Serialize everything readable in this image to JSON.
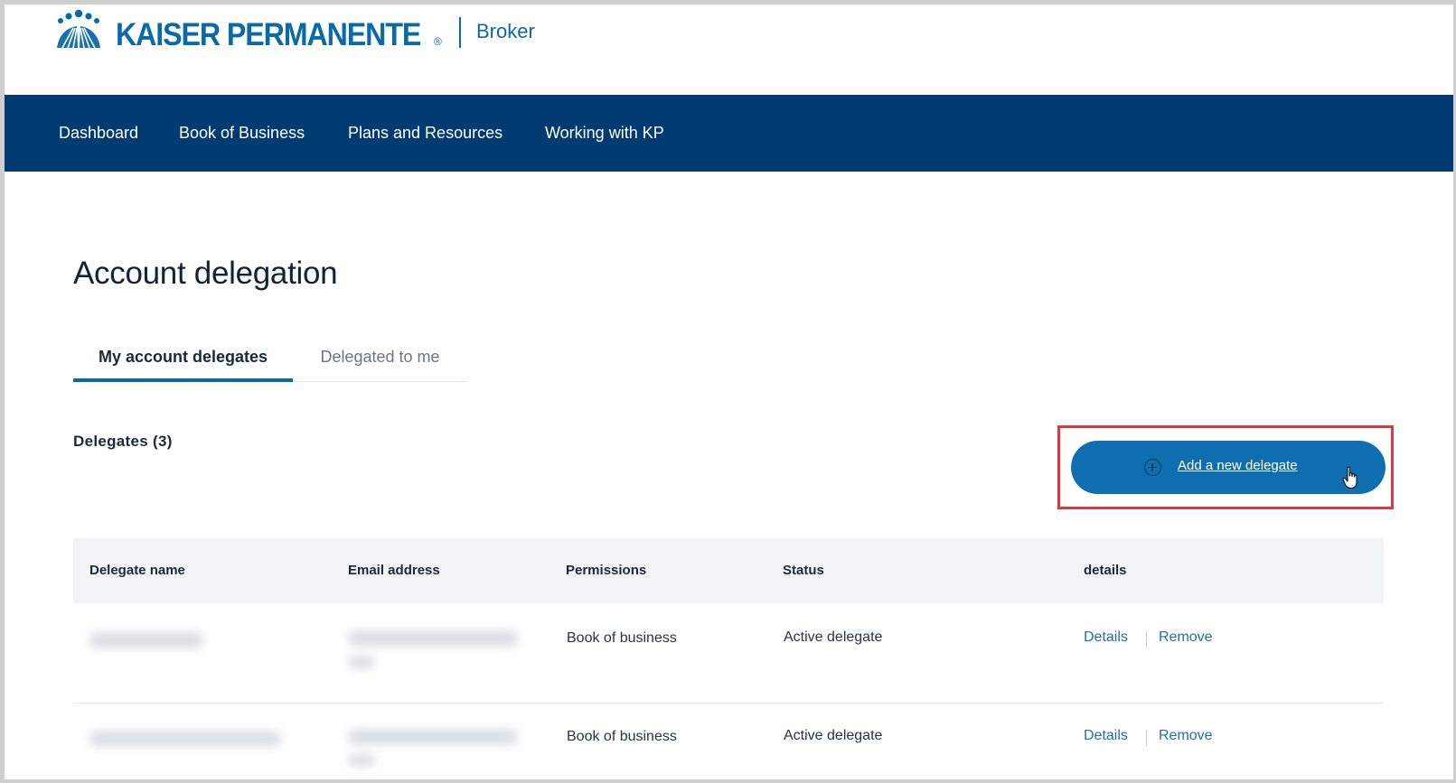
{
  "brand": {
    "name": "KAISER PERMANENTE",
    "registered_mark": "®",
    "portal": "Broker",
    "color": "#0a6aa8"
  },
  "nav": {
    "items": [
      {
        "label": "Dashboard"
      },
      {
        "label": "Book of Business"
      },
      {
        "label": "Plans and Resources"
      },
      {
        "label": "Working with KP"
      }
    ],
    "background": "#013b72"
  },
  "page": {
    "title": "Account delegation"
  },
  "tabs": [
    {
      "label": "My account delegates",
      "active": true
    },
    {
      "label": "Delegated to me",
      "active": false
    }
  ],
  "delegates": {
    "heading": "Delegates (3)",
    "add_button_label": "Add a new delegate",
    "add_button_icon": "plus-circle-icon",
    "highlight_color": "#e0383e"
  },
  "table": {
    "headers": [
      "Delegate name",
      "Email address",
      "Permissions",
      "Status",
      "details"
    ],
    "rows": [
      {
        "name": "",
        "email": "",
        "permissions": "Book of business",
        "status": "Active delegate",
        "details_link": "Details",
        "remove_link": "Remove"
      },
      {
        "name": "",
        "email": "",
        "permissions": "Book of business",
        "status": "Active delegate",
        "details_link": "Details",
        "remove_link": "Remove"
      }
    ]
  }
}
